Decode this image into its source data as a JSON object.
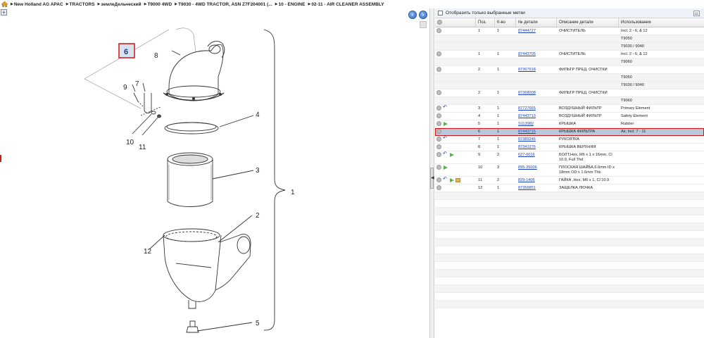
{
  "breadcrumb": {
    "items": [
      "New Holland AG APAC",
      "TRACTORS",
      "землеДельческий",
      "T9000 4WD",
      "T9030 - 4WD TRACTOR, ASN Z7F204001 (...",
      "10 - ENGINE",
      "02-11 - AIR CLEANER ASSEMBLY"
    ]
  },
  "drawing": {
    "callouts": [
      "1",
      "2",
      "3",
      "4",
      "5",
      "6",
      "7",
      "8",
      "9",
      "10",
      "11",
      "12"
    ],
    "selected_callout": "6"
  },
  "filter": {
    "label": "Отобразить только выбранные метки"
  },
  "table": {
    "headers": {
      "pos": "Поз.",
      "qty": "К-во",
      "part": "№ детали",
      "desc": "Описание детали",
      "use": "Использование"
    },
    "rows": [
      {
        "pos": "1",
        "qty": "1",
        "part": "87444727",
        "desc": "ОЧИСТИТЕЛЬ",
        "use": "Incl. 2 - 6, & 12",
        "icons": [
          "info"
        ]
      },
      {
        "pos": "",
        "qty": "",
        "part": "",
        "desc": "",
        "use": "T9050",
        "icons": []
      },
      {
        "pos": "",
        "qty": "",
        "part": "",
        "desc": "",
        "use": "T9030 / 9040",
        "icons": []
      },
      {
        "pos": "1",
        "qty": "1",
        "part": "87443705",
        "desc": "ОЧИСТИТЕЛЬ",
        "use": "Incl. 2 - 6, & 12",
        "icons": [
          "info"
        ]
      },
      {
        "pos": "",
        "qty": "",
        "part": "",
        "desc": "",
        "use": "T9060",
        "icons": []
      },
      {
        "pos": "2",
        "qty": "1",
        "part": "87367918",
        "desc": "ФИЛЬТР ПРЕД. ОЧИСТКИ",
        "use": "",
        "icons": [
          "info"
        ]
      },
      {
        "pos": "",
        "qty": "",
        "part": "",
        "desc": "",
        "use": "T9050",
        "icons": []
      },
      {
        "pos": "",
        "qty": "",
        "part": "",
        "desc": "",
        "use": "T9030 / 9040",
        "icons": []
      },
      {
        "pos": "2",
        "qty": "1",
        "part": "87368008",
        "desc": "ФИЛЬТР ПРЕД. ОЧИСТКИ",
        "use": "",
        "icons": [
          "info"
        ]
      },
      {
        "pos": "",
        "qty": "",
        "part": "",
        "desc": "",
        "use": "T9060",
        "icons": []
      },
      {
        "pos": "3",
        "qty": "1",
        "part": "87727665",
        "desc": "ВОЗДУШНЫЙ ФИЛЬТР",
        "use": "Primary Element",
        "icons": [
          "info",
          "link"
        ]
      },
      {
        "pos": "4",
        "qty": "1",
        "part": "87443713",
        "desc": "ВОЗДУШНЫЙ ФИЛЬТР",
        "use": "Safety Element",
        "icons": [
          "info"
        ]
      },
      {
        "pos": "5",
        "qty": "1",
        "part": "S113982",
        "desc": "КРЫШКА",
        "use": "Rubber",
        "icons": [
          "info",
          "arrow"
        ]
      },
      {
        "pos": "6",
        "qty": "1",
        "part": "87443715",
        "desc": "КРЫШКА ФИЛЬТРА",
        "use": "Air, Incl. 7 - 11",
        "icons": [
          "info"
        ],
        "selected": true
      },
      {
        "pos": "7",
        "qty": "1",
        "part": "87389246",
        "desc": "РУКОЯТКА",
        "use": "",
        "icons": [
          "info",
          "link"
        ]
      },
      {
        "pos": "8",
        "qty": "1",
        "part": "87341276",
        "desc": "КРЫШКА ВЕРХНЯЯ",
        "use": "",
        "icons": [
          "info"
        ]
      },
      {
        "pos": "9",
        "qty": "2",
        "part": "627-6016",
        "desc": "БОЛТ,Hex, M6 x 1 x 16mm, Cl 10.9, Full Thd",
        "use": "",
        "icons": [
          "info",
          "link",
          "arrow"
        ],
        "tall": true
      },
      {
        "pos": "10",
        "qty": "3",
        "part": "895-25006",
        "desc": "ПЛОСКАЯ ШАЙБА,6.6mm ID x 18mm OD x 1.6mm Thk",
        "use": "",
        "icons": [
          "info",
          "arrow"
        ],
        "tall": true
      },
      {
        "pos": "11",
        "qty": "2",
        "part": "829-1406",
        "desc": "ГАЙКА ,Hex, M6 x 1, Cl 10.9",
        "use": "",
        "icons": [
          "info",
          "link",
          "arrow",
          "box"
        ]
      },
      {
        "pos": "12",
        "qty": "1",
        "part": "87356851",
        "desc": "ЗАЩЕЛКА ЛЮЧКА",
        "use": "",
        "icons": [
          "info"
        ]
      }
    ],
    "empty_rows": 15
  },
  "colors": {
    "selected_row": "#b8c9db",
    "highlight_border": "#d01515",
    "link": "#1a3fc0"
  }
}
